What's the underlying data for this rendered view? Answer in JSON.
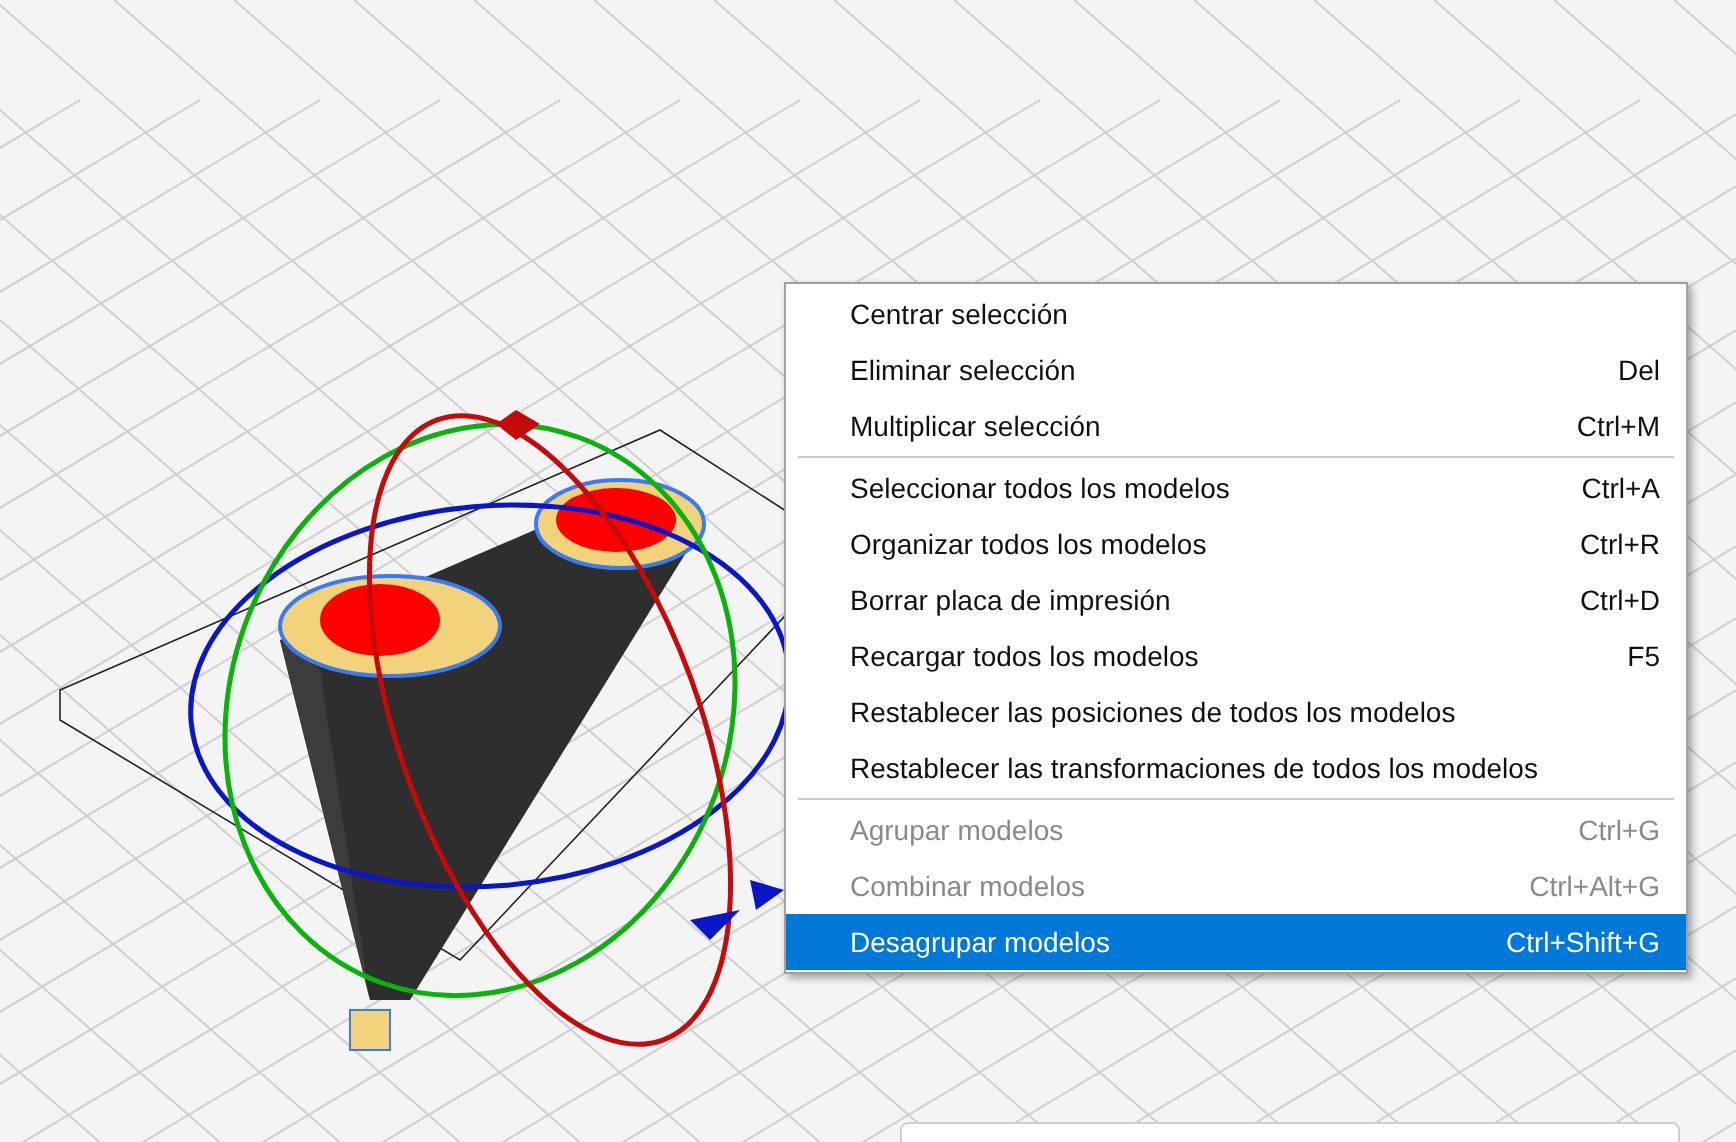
{
  "context_menu": {
    "entries": [
      {
        "kind": "item",
        "label": "Centrar selección",
        "disabled": false,
        "selected": false
      },
      {
        "kind": "item",
        "label": "Eliminar selección",
        "shortcut": "Del",
        "disabled": false,
        "selected": false
      },
      {
        "kind": "item",
        "label": "Multiplicar selección",
        "shortcut": "Ctrl+M",
        "disabled": false,
        "selected": false
      },
      {
        "kind": "separator"
      },
      {
        "kind": "item",
        "label": "Seleccionar todos los modelos",
        "shortcut": "Ctrl+A",
        "disabled": false,
        "selected": false
      },
      {
        "kind": "item",
        "label": "Organizar todos los modelos",
        "shortcut": "Ctrl+R",
        "disabled": false,
        "selected": false
      },
      {
        "kind": "item",
        "label": "Borrar placa de impresión",
        "shortcut": "Ctrl+D",
        "disabled": false,
        "selected": false
      },
      {
        "kind": "item",
        "label": "Recargar todos los modelos",
        "shortcut": "F5",
        "disabled": false,
        "selected": false
      },
      {
        "kind": "item",
        "label": "Restablecer las posiciones de todos los modelos",
        "disabled": false,
        "selected": false
      },
      {
        "kind": "item",
        "label": "Restablecer las transformaciones de todos los modelos",
        "disabled": false,
        "selected": false
      },
      {
        "kind": "separator"
      },
      {
        "kind": "item",
        "label": "Agrupar modelos",
        "shortcut": "Ctrl+G",
        "disabled": true,
        "selected": false
      },
      {
        "kind": "item",
        "label": "Combinar modelos",
        "shortcut": "Ctrl+Alt+G",
        "disabled": true,
        "selected": false
      },
      {
        "kind": "item",
        "label": "Desagrupar modelos",
        "shortcut": "Ctrl+Shift+G",
        "disabled": false,
        "selected": true
      }
    ]
  }
}
